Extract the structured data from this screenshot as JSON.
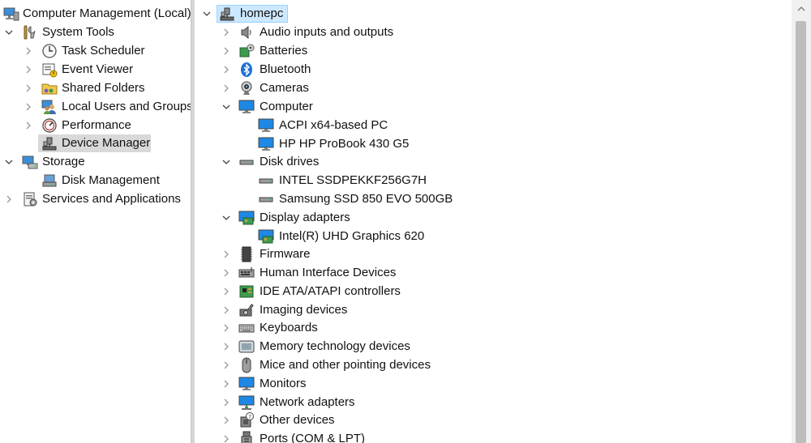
{
  "left_tree": {
    "root": "Computer Management (Local)",
    "system_tools": "System Tools",
    "task_scheduler": "Task Scheduler",
    "event_viewer": "Event Viewer",
    "shared_folders": "Shared Folders",
    "local_users": "Local Users and Groups",
    "performance": "Performance",
    "device_manager": "Device Manager",
    "storage": "Storage",
    "disk_management": "Disk Management",
    "services": "Services and Applications"
  },
  "device_tree": {
    "root": "homepc",
    "audio": "Audio inputs and outputs",
    "batteries": "Batteries",
    "bluetooth": "Bluetooth",
    "cameras": "Cameras",
    "computer": "Computer",
    "computer_children": [
      "ACPI x64-based PC",
      "HP HP ProBook 430 G5"
    ],
    "disk_drives": "Disk drives",
    "disk_children": [
      "INTEL SSDPEKKF256G7H",
      "Samsung SSD 850 EVO 500GB"
    ],
    "display_adapters": "Display adapters",
    "display_children": [
      "Intel(R) UHD Graphics 620"
    ],
    "firmware": "Firmware",
    "hid": "Human Interface Devices",
    "ide": "IDE ATA/ATAPI controllers",
    "imaging": "Imaging devices",
    "keyboards": "Keyboards",
    "memory": "Memory technology devices",
    "mice": "Mice and other pointing devices",
    "monitors": "Monitors",
    "network": "Network adapters",
    "other": "Other devices",
    "ports": "Ports (COM & LPT)"
  },
  "colors": {
    "selection_highlight": "#d9d9d9",
    "root_selection": "#cce8ff",
    "monitor_blue": "#1e88e5"
  }
}
